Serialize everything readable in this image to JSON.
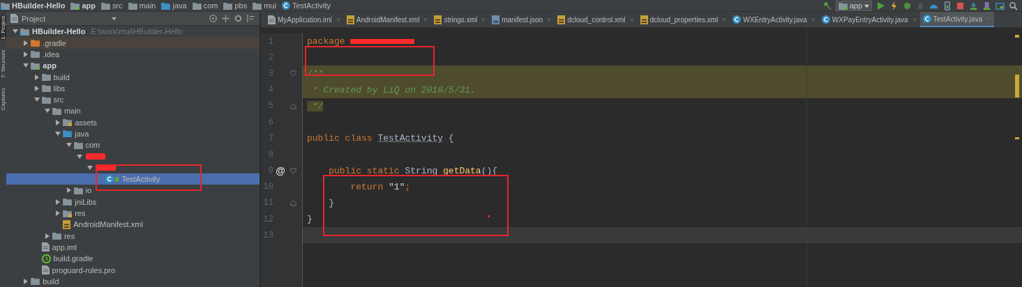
{
  "breadcrumbs": [
    {
      "label": "HBuilder-Hello",
      "kind": "project"
    },
    {
      "label": "app",
      "kind": "module"
    },
    {
      "label": "src",
      "kind": "folder"
    },
    {
      "label": "main",
      "kind": "folder"
    },
    {
      "label": "java",
      "kind": "source"
    },
    {
      "label": "com",
      "kind": "package"
    },
    {
      "label": "pbs",
      "kind": "package"
    },
    {
      "label": "mui",
      "kind": "package"
    },
    {
      "label": "TestActivity",
      "kind": "class"
    }
  ],
  "toolbar": {
    "run_config": "app"
  },
  "side_strip": [
    {
      "label": "1: Project",
      "selected": true
    },
    {
      "label": "7: Structure",
      "selected": false
    },
    {
      "label": "Captures",
      "selected": false
    }
  ],
  "project_panel": {
    "title": "Project",
    "tree": [
      {
        "label": "HBuilder-Hello",
        "path": "E:\\work\\mui\\HBuilder-Hello",
        "kind": "project",
        "expanded": true,
        "selected": false,
        "children": [
          {
            "label": ".gradle",
            "kind": "folder-excluded",
            "expanded": false,
            "selected": false
          },
          {
            "label": ".idea",
            "kind": "folder",
            "expanded": false,
            "selected": false
          },
          {
            "label": "app",
            "kind": "folder-module",
            "expanded": true,
            "selected": false,
            "children": [
              {
                "label": "build",
                "kind": "folder",
                "expanded": false,
                "selected": false
              },
              {
                "label": "libs",
                "kind": "folder",
                "expanded": false,
                "selected": false
              },
              {
                "label": "src",
                "kind": "folder",
                "expanded": true,
                "selected": false,
                "children": [
                  {
                    "label": "main",
                    "kind": "folder",
                    "expanded": true,
                    "selected": false,
                    "children": [
                      {
                        "label": "assets",
                        "kind": "folder-res",
                        "expanded": false,
                        "selected": false
                      },
                      {
                        "label": "java",
                        "kind": "folder-source",
                        "expanded": true,
                        "selected": false,
                        "children": [
                          {
                            "label": "com",
                            "kind": "package",
                            "expanded": true,
                            "selected": false,
                            "children": [
                              {
                                "kind": "redacted",
                                "expanded": true,
                                "selected": false,
                                "children": [
                                  {
                                    "kind": "redacted",
                                    "expanded": true,
                                    "selected": false,
                                    "children": [
                                      {
                                        "label": "TestActivity",
                                        "kind": "class",
                                        "selected": true
                                      }
                                    ]
                                  }
                                ]
                              }
                            ]
                          },
                          {
                            "label": "io",
                            "kind": "package",
                            "expanded": false,
                            "selected": false
                          }
                        ]
                      },
                      {
                        "label": "jniLibs",
                        "kind": "folder",
                        "expanded": false,
                        "selected": false
                      },
                      {
                        "label": "res",
                        "kind": "folder-res",
                        "expanded": false,
                        "selected": false
                      },
                      {
                        "label": "AndroidManifest.xml",
                        "kind": "manifest",
                        "selected": false
                      }
                    ]
                  },
                  {
                    "label": "res",
                    "kind": "folder",
                    "expanded": false,
                    "selected": false
                  }
                ]
              },
              {
                "label": "app.iml",
                "kind": "iml",
                "selected": false
              },
              {
                "label": "build.gradle",
                "kind": "gradle",
                "selected": false
              },
              {
                "label": "proguard-rules.pro",
                "kind": "file",
                "selected": false
              }
            ]
          },
          {
            "label": "build",
            "kind": "folder",
            "expanded": false,
            "selected": false
          }
        ]
      }
    ]
  },
  "tabs": [
    {
      "label": "MyApplication.iml",
      "kind": "iml",
      "selected": false
    },
    {
      "label": "AndroidManifest.xml",
      "kind": "manifest",
      "selected": false
    },
    {
      "label": "strings.xml",
      "kind": "xml",
      "selected": false
    },
    {
      "label": "manifest.json",
      "kind": "json",
      "selected": false
    },
    {
      "label": "dcloud_control.xml",
      "kind": "xml",
      "selected": false
    },
    {
      "label": "dcloud_properties.xml",
      "kind": "xml",
      "selected": false
    },
    {
      "label": "WXEntryActivity.java",
      "kind": "java",
      "selected": false
    },
    {
      "label": "WXPayEntryActivity.java",
      "kind": "java",
      "selected": false
    },
    {
      "label": "TestActivity.java",
      "kind": "java",
      "selected": true
    }
  ],
  "editor": {
    "lines": [
      {
        "number": "1",
        "highlighted": false,
        "current": false,
        "tokens": [
          {
            "text": "package ",
            "kind": "keyword"
          },
          {
            "kind": "redacted"
          }
        ]
      },
      {
        "number": "2",
        "highlighted": false,
        "current": false
      },
      {
        "number": "3",
        "highlighted": true,
        "current": false,
        "fold_start": true,
        "tokens": [
          {
            "text": "/**",
            "kind": "comment"
          }
        ]
      },
      {
        "number": "4",
        "highlighted": true,
        "current": false,
        "tokens": [
          {
            "text": " * Created by LiQ on 2018/5/31.",
            "kind": "comment"
          }
        ]
      },
      {
        "number": "5",
        "highlighted": false,
        "current": false,
        "fold_end": true,
        "tokens": [
          {
            "text": " */",
            "kind": "comment-highlighted"
          }
        ]
      },
      {
        "number": "6",
        "highlighted": false,
        "current": false
      },
      {
        "number": "7",
        "highlighted": false,
        "current": false,
        "tokens": [
          {
            "text": "public class ",
            "kind": "keyword"
          },
          {
            "text": "TestActivity",
            "kind": "unused"
          },
          {
            "text": " {",
            "kind": "plain"
          }
        ]
      },
      {
        "number": "8",
        "highlighted": false,
        "current": false
      },
      {
        "number": "9",
        "highlighted": false,
        "current": false,
        "marker": "@",
        "fold_start": true,
        "tokens": [
          {
            "text": "    public static ",
            "kind": "keyword"
          },
          {
            "text": "String ",
            "kind": "plain"
          },
          {
            "text": "getData",
            "kind": "method"
          },
          {
            "text": "(){",
            "kind": "plain"
          }
        ]
      },
      {
        "number": "10",
        "highlighted": false,
        "current": false,
        "tokens": [
          {
            "text": "        return ",
            "kind": "keyword"
          },
          {
            "text": "\"1\"",
            "kind": "string"
          },
          {
            "text": ";",
            "kind": "keyword"
          }
        ]
      },
      {
        "number": "11",
        "highlighted": false,
        "current": false,
        "fold_end": true,
        "tokens": [
          {
            "text": "    }",
            "kind": "plain"
          }
        ]
      },
      {
        "number": "12",
        "highlighted": false,
        "current": false,
        "tokens": [
          {
            "text": "}",
            "kind": "plain"
          }
        ]
      },
      {
        "number": "13",
        "highlighted": false,
        "current": true
      }
    ]
  }
}
